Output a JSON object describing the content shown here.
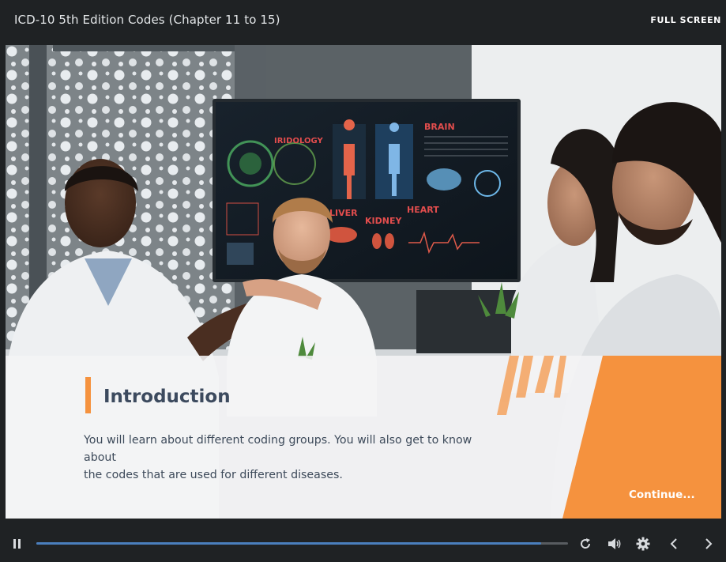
{
  "header": {
    "course_title": "ICD-10 5th Edition Codes (Chapter 11 to 15)",
    "fullscreen_label": "FULL SCREEN"
  },
  "slide": {
    "heading": "Introduction",
    "body_lines": [
      "You will learn about different coding groups. You will also get to know about",
      "the codes that are used for different diseases."
    ],
    "continue_label": "Continue...",
    "screen_labels": {
      "iridology": "IRIDOLOGY",
      "brain": "BRAIN",
      "liver": "LIVER",
      "kidney": "KIDNEY",
      "heart": "HEART"
    }
  },
  "player": {
    "progress": 0.95,
    "icons": [
      "pause-icon",
      "replay-icon",
      "volume-icon",
      "settings-icon",
      "previous-icon",
      "next-icon"
    ]
  },
  "colors": {
    "accent_orange": "#f5923e",
    "heading_navy": "#3c4a5e",
    "progress_blue": "#4a7fbd",
    "chrome_dark": "#1f2224"
  }
}
